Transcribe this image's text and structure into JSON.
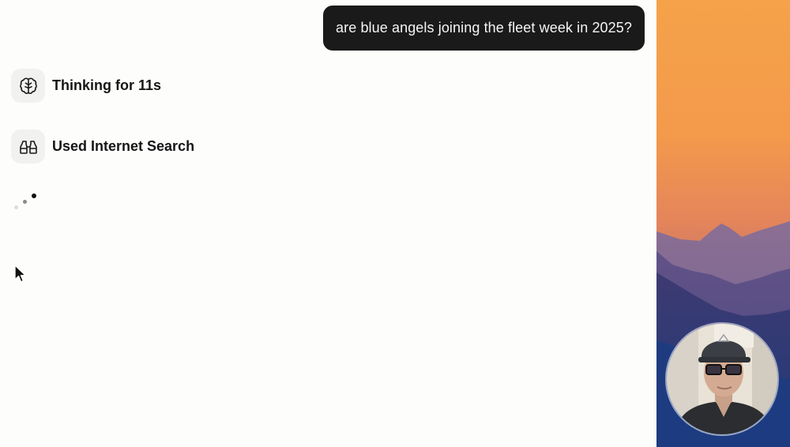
{
  "conversation": {
    "user_message": "are blue angels joining the fleet week in 2025?",
    "steps": [
      {
        "icon": "brain-icon",
        "label": "Thinking for 11s"
      },
      {
        "icon": "binoculars-icon",
        "label": "Used Internet Search"
      }
    ]
  },
  "colors": {
    "bubble_background": "#1a1a1a",
    "page_background": "#fdfdfc",
    "sunset_top": "#f5a24a",
    "mountain_shadow": "#3d3a76"
  }
}
